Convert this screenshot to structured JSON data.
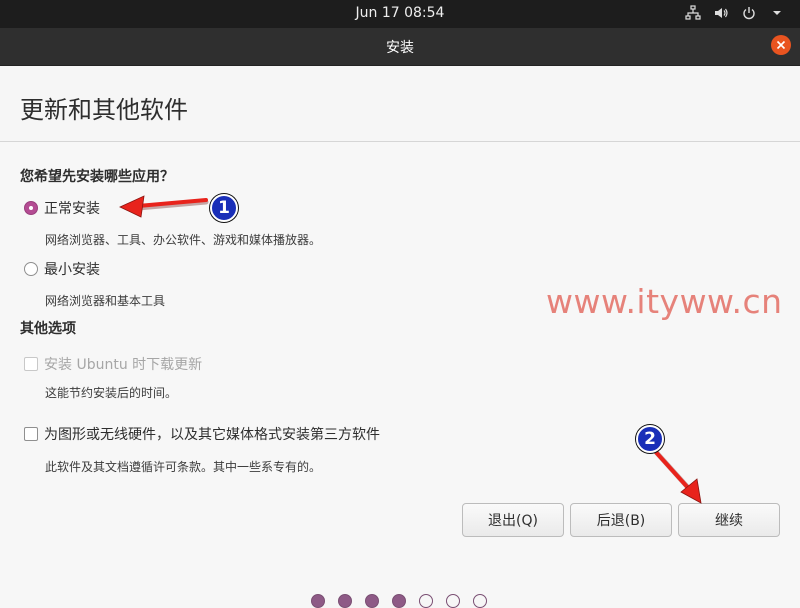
{
  "topbar": {
    "clock": "Jun 17  08:54"
  },
  "window": {
    "title": "安装"
  },
  "page": {
    "title": "更新和其他软件"
  },
  "install_question": "您希望先安装哪些应用？",
  "options": {
    "normal": {
      "label": "正常安装",
      "desc": "网络浏览器、工具、办公软件、游戏和媒体播放器。",
      "selected": true
    },
    "minimal": {
      "label": "最小安装",
      "desc": "网络浏览器和基本工具",
      "selected": false
    }
  },
  "other_section": "其他选项",
  "download_updates": {
    "label": "安装 Ubuntu 时下载更新",
    "desc": "这能节约安装后的时间。",
    "disabled": true
  },
  "third_party": {
    "label": "为图形或无线硬件，以及其它媒体格式安装第三方软件",
    "desc": "此软件及其文档遵循许可条款。其中一些系专有的。"
  },
  "buttons": {
    "quit": "退出(Q)",
    "back": "后退(B)",
    "continue": "继续"
  },
  "watermark": "www.ityww.cn",
  "annotations": {
    "one": "1",
    "two": "2"
  },
  "colors": {
    "accent": "#e95420",
    "radio_selected": "#b44c93",
    "annotation_arrow": "#e8231c",
    "badge": "#1a2fb8"
  },
  "progress": {
    "total_steps": 7,
    "completed_steps": 4
  }
}
